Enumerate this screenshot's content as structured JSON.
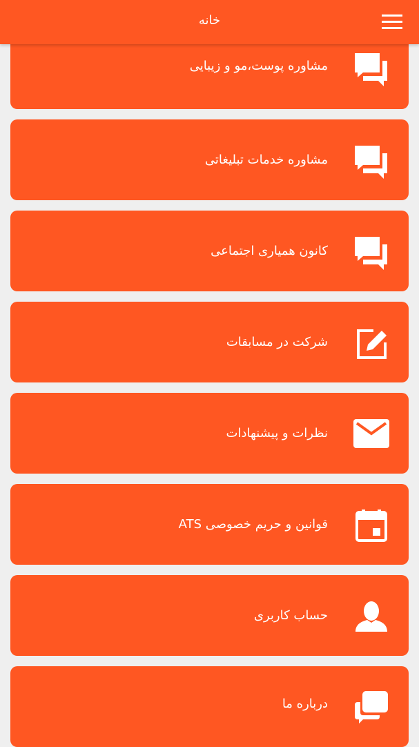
{
  "header": {
    "title": "خانه",
    "menu_icon": "hamburger-menu-icon"
  },
  "colors": {
    "accent": "#ff5722",
    "background": "#efefef",
    "text": "#ffffff"
  },
  "menu": {
    "items": [
      {
        "label": "مشاوره پوست،مو و زیبایی",
        "icon": "chat-bubbles-icon"
      },
      {
        "label": "مشاوره خدمات تبلیغاتی",
        "icon": "chat-bubbles-icon"
      },
      {
        "label": "کانون همیاری اجتماعی",
        "icon": "chat-bubbles-icon"
      },
      {
        "label": "شرکت در مسابقات",
        "icon": "edit-icon"
      },
      {
        "label": "نظرات و پیشنهادات",
        "icon": "mail-icon"
      },
      {
        "label": "قوانین و حریم خصوصی ATS",
        "icon": "calendar-icon"
      },
      {
        "label": "حساب کاربری",
        "icon": "person-icon"
      },
      {
        "label": "درباره ما",
        "icon": "conversation-icon"
      }
    ]
  }
}
